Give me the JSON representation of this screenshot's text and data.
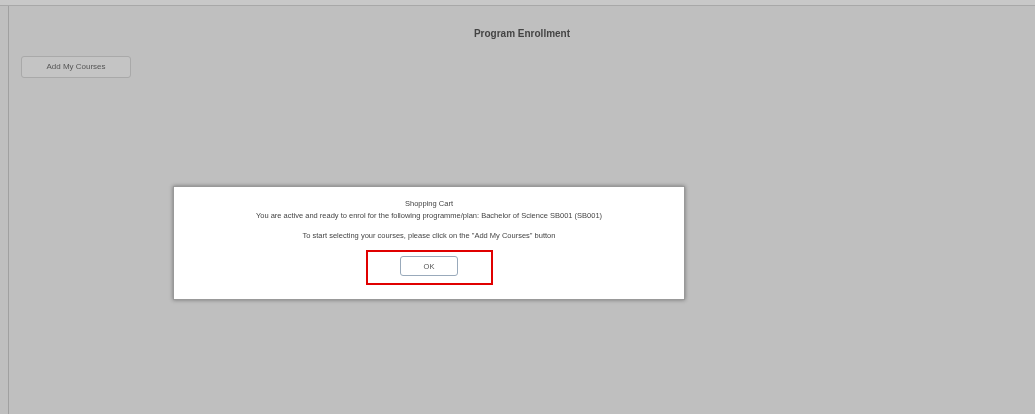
{
  "page": {
    "title": "Program Enrollment",
    "add_button": "Add My Courses"
  },
  "dialog": {
    "title": "Shopping Cart",
    "message": "You are active and ready to enrol for the following programme/plan: Bachelor of Science SB001 (SB001)",
    "instruction": "To start selecting your courses, please click on the \"Add My Courses\" button",
    "ok_button": "OK",
    "ok_highlighted": true
  }
}
